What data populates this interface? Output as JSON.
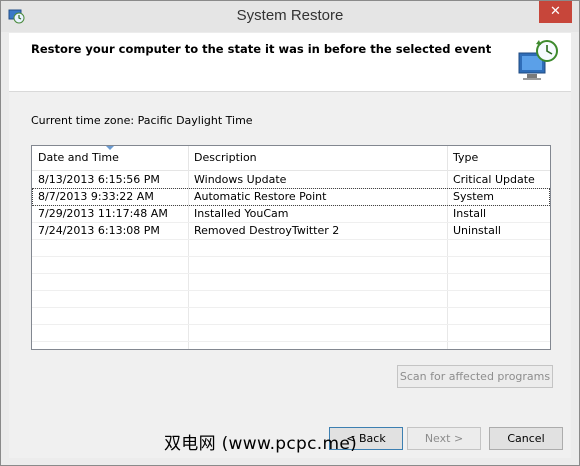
{
  "window": {
    "title": "System Restore",
    "close_label": "✕"
  },
  "header": {
    "title": "Restore your computer to the state it was in before the selected event"
  },
  "timezone": "Current time zone: Pacific Daylight Time",
  "list": {
    "columns": [
      "Date and Time",
      "Description",
      "Type"
    ],
    "rows": [
      [
        "8/13/2013 6:15:56 PM",
        "Windows Update",
        "Critical Update"
      ],
      [
        "8/7/2013 9:33:22 AM",
        "Automatic Restore Point",
        "System"
      ],
      [
        "7/29/2013 11:17:48 AM",
        "Installed YouCam",
        "Install"
      ],
      [
        "7/24/2013 6:13:08 PM",
        "Removed DestroyTwitter 2",
        "Uninstall"
      ]
    ],
    "selected_row": 1
  },
  "buttons": {
    "scan": "Scan for affected programs",
    "back": "< Back",
    "next": "Next >",
    "cancel": "Cancel"
  },
  "watermark": "双电网 (www.pcpc.me)",
  "icons": {
    "app": "system-restore-icon",
    "header": "computer-restore-clock-icon"
  },
  "colors": {
    "close": "#c7463a",
    "accent": "#3c7fb1"
  }
}
